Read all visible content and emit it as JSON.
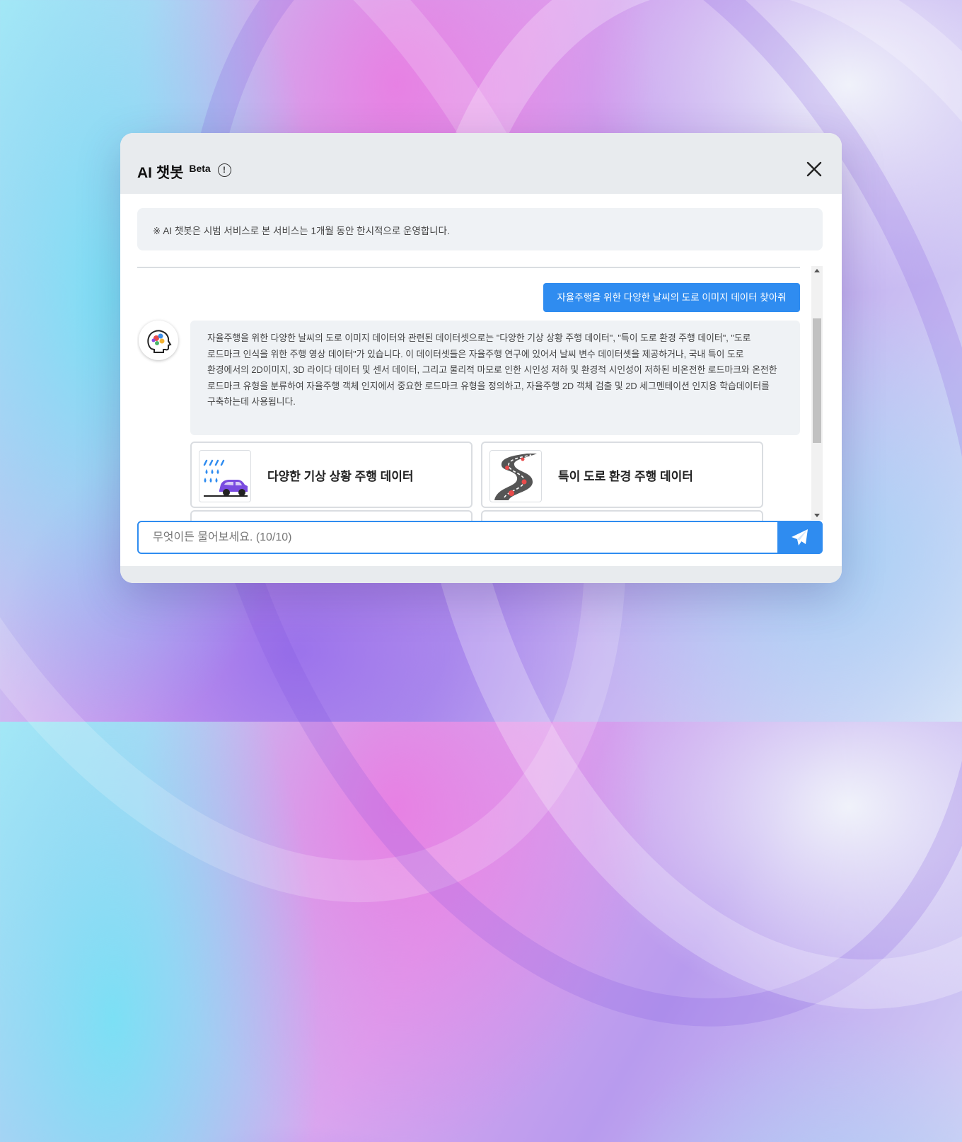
{
  "dialog": {
    "title": "AI 챗봇",
    "beta_label": "Beta",
    "info_icon": "info-circle-icon",
    "close_icon": "close-icon"
  },
  "notice": {
    "text": "※ AI 챗봇은 시범 서비스로 본 서비스는 1개월 동안 한시적으로 운영합니다."
  },
  "chat": {
    "user_message": "자율주행을 위한 다양한 날씨의 도로 이미지 데이터 찾아줘",
    "bot_avatar_icon": "ai-brain-head-icon",
    "bot_message": "자율주행을 위한 다양한 날씨의 도로 이미지 데이터와 관련된 데이터셋으로는 \"다양한 기상 상황 주행 데이터\", \"특이 도로 환경 주행 데이터\", \"도로 로드마크 인식을 위한 주행 영상 데이터\"가 있습니다. 이 데이터셋들은 자율주행 연구에 있어서 날씨 변수 데이터셋을 제공하거나, 국내 특이 도로 환경에서의 2D이미지, 3D 라이다 데이터 및 센서 데이터, 그리고 물리적 마모로 인한 시인성 저하 및 환경적 시인성이 저하된 비온전한 로드마크와 온전한 로드마크 유형을 분류하여 자율주행 객체 인지에서 중요한 로드마크 유형을 정의하고, 자율주행 2D 객체 검출 및 2D 세그멘테이션 인지용 학습데이터를 구축하는데 사용됩니다.",
    "cards": [
      {
        "title": "다양한 기상 상황 주행 데이터",
        "icon": "rain-car-icon"
      },
      {
        "title": "특이 도로 환경 주행 데이터",
        "icon": "winding-road-icon"
      }
    ]
  },
  "input": {
    "placeholder": "무엇이든 물어보세요. (10/10)",
    "send_icon": "paper-plane-icon"
  },
  "colors": {
    "accent": "#2f8cf0",
    "header_bg": "#e8ebee",
    "bubble_bg": "#eff2f5"
  }
}
